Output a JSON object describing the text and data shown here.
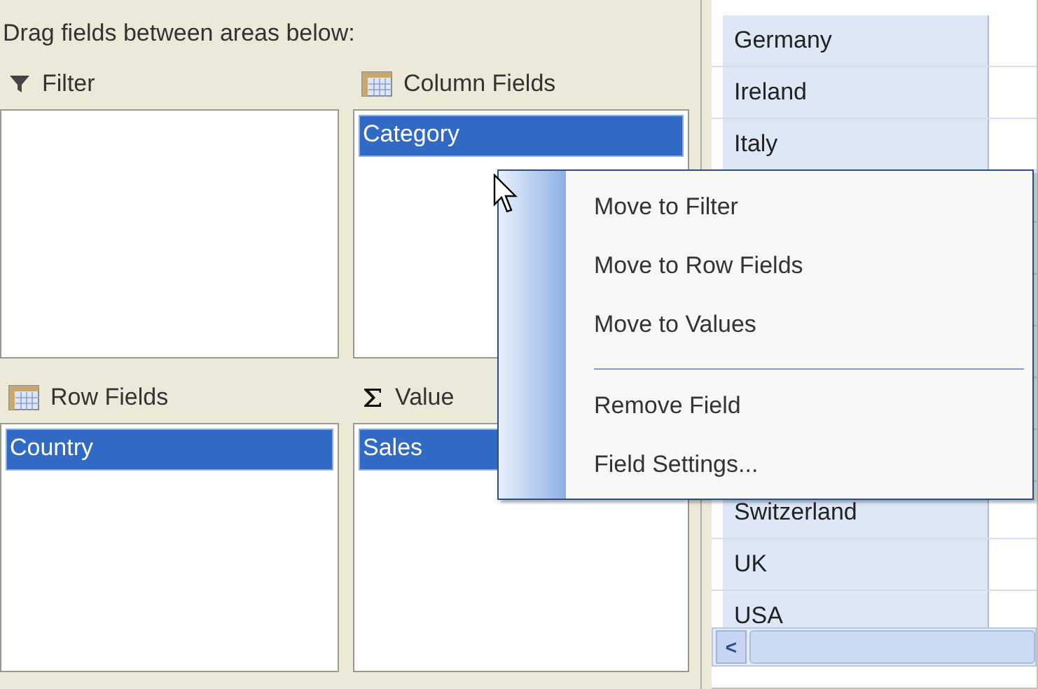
{
  "instructions": "Drag fields between areas below:",
  "areas": [
    {
      "kind": "filter",
      "title": "Filter"
    },
    {
      "kind": "column",
      "title": "Column Fields",
      "fields": [
        {
          "label": "Category",
          "selected": true
        }
      ]
    },
    {
      "kind": "row",
      "title": "Row Fields",
      "fields": [
        {
          "label": "Country",
          "selected": true
        }
      ]
    },
    {
      "kind": "values",
      "title": "Value",
      "fields": [
        {
          "label": "Sales",
          "selected": true
        }
      ]
    }
  ],
  "grid": {
    "rows_above_menu": [
      "Germany",
      "Ireland",
      "Italy"
    ],
    "rows_below_menu": [
      "Switzerland",
      "UK",
      "USA"
    ],
    "scroll_left": "<"
  },
  "context_menu": {
    "items": [
      {
        "kind": "item",
        "label": "Move to Filter"
      },
      {
        "kind": "item",
        "label": "Move to Row Fields"
      },
      {
        "kind": "item",
        "label": "Move to Values"
      },
      {
        "kind": "separator"
      },
      {
        "kind": "item",
        "label": "Remove Field"
      },
      {
        "kind": "item",
        "label": "Field Settings..."
      }
    ]
  }
}
